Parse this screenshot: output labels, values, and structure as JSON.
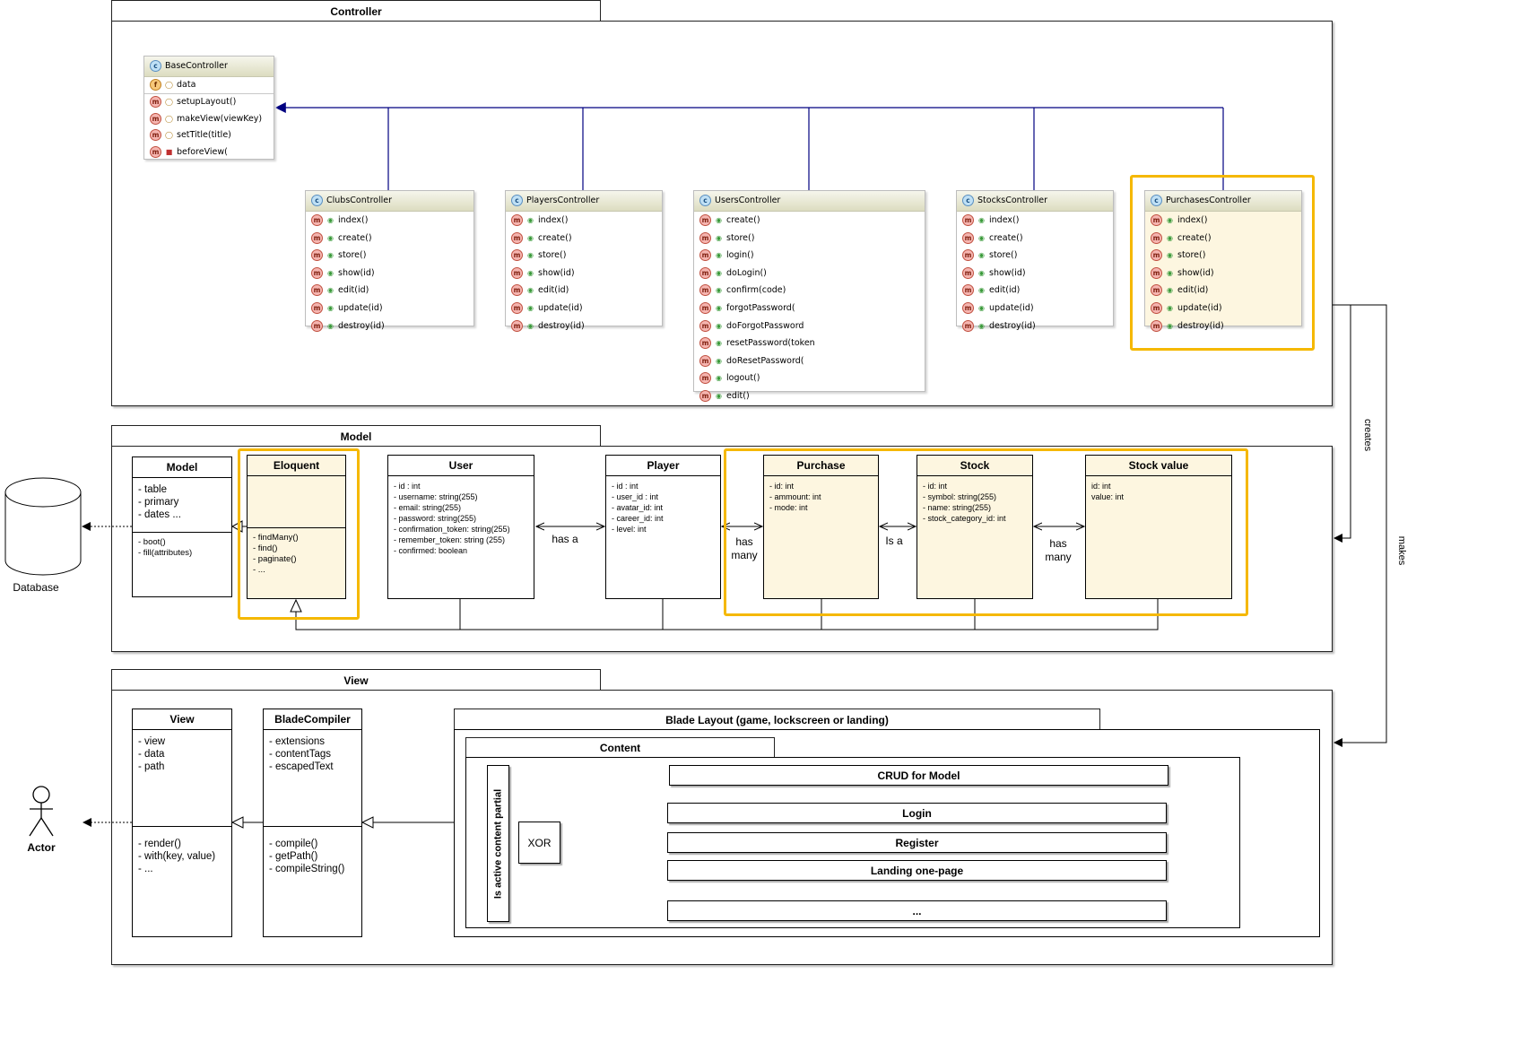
{
  "packages": {
    "controller": "Controller",
    "model": "Model",
    "view": "View"
  },
  "controllers": {
    "base": {
      "name": "BaseController",
      "field": "data",
      "methods": [
        "setupLayout()",
        "makeView(viewKey)",
        "setTitle(title)",
        "beforeView("
      ]
    },
    "clubs": {
      "name": "ClubsController",
      "methods": [
        "index()",
        "create()",
        "store()",
        "show(id)",
        "edit(id)",
        "update(id)",
        "destroy(id)"
      ]
    },
    "players": {
      "name": "PlayersController",
      "methods": [
        "index()",
        "create()",
        "store()",
        "show(id)",
        "edit(id)",
        "update(id)",
        "destroy(id)"
      ]
    },
    "users": {
      "name": "UsersController",
      "methods": [
        "create()",
        "store()",
        "login()",
        "doLogin()",
        "confirm(code)",
        "forgotPassword(",
        "doForgotPassword",
        "resetPassword(token",
        "doResetPassword(",
        "logout()",
        "edit()"
      ]
    },
    "stocks": {
      "name": "StocksController",
      "methods": [
        "index()",
        "create()",
        "store()",
        "show(id)",
        "edit(id)",
        "update(id)",
        "destroy(id)"
      ]
    },
    "purchases": {
      "name": "PurchasesController",
      "methods": [
        "index()",
        "create()",
        "store()",
        "show(id)",
        "edit(id)",
        "update(id)",
        "destroy(id)"
      ]
    }
  },
  "database_label": "Database",
  "models": {
    "model": {
      "name": "Model",
      "attrs": [
        "- table",
        "- primary",
        "- dates ..."
      ],
      "ops": [
        "- boot()",
        "- fill(attributes)"
      ]
    },
    "eloquent": {
      "name": "Eloquent",
      "ops": [
        "- findMany()",
        "- find()",
        "- paginate()",
        "- ..."
      ]
    },
    "user": {
      "name": "User",
      "attrs": [
        "- id : int",
        "- username: string(255)",
        "- email: string(255)",
        "- password: string(255)",
        "- confirmation_token: string(255)",
        "- remember_token: string (255)",
        "- confirmed: boolean"
      ]
    },
    "player": {
      "name": "Player",
      "attrs": [
        "- id : int",
        "- user_id : int",
        "- avatar_id: int",
        "- career_id: int",
        "- level: int"
      ]
    },
    "purchase": {
      "name": "Purchase",
      "attrs": [
        "- id: int",
        "- ammount: int",
        "- mode: int"
      ]
    },
    "stock": {
      "name": "Stock",
      "attrs": [
        "- id: int",
        "- symbol: string(255)",
        "- name: string(255)",
        "- stock_category_id: int"
      ]
    },
    "stock_value": {
      "name": "Stock value",
      "attrs": [
        "id: int",
        "value: int"
      ]
    }
  },
  "relations": {
    "user_player": "has a",
    "player_purchase": [
      "has",
      "many"
    ],
    "purchase_stock": "Is a",
    "stock_value": [
      "has",
      "many"
    ]
  },
  "side_labels": {
    "creates": "creates",
    "makes": "makes"
  },
  "actor_label": "Actor",
  "view": {
    "view": {
      "name": "View",
      "attrs": [
        "- view",
        "- data",
        "- path"
      ],
      "ops": [
        "- render()",
        "- with(key, value)",
        "- ..."
      ]
    },
    "blade": {
      "name": "BladeCompiler",
      "attrs": [
        "- extensions",
        "- contentTags",
        "- escapedText"
      ],
      "ops": [
        "- compile()",
        "- getPath()",
        "- compileString()"
      ]
    },
    "layout_title": "Blade Layout (game, lockscreen or landing)",
    "content_title": "Content",
    "partial_label": "Is active content partial",
    "xor": "XOR",
    "options": [
      "CRUD for Model",
      "Login",
      "Register",
      "Landing one-page",
      "..."
    ]
  }
}
